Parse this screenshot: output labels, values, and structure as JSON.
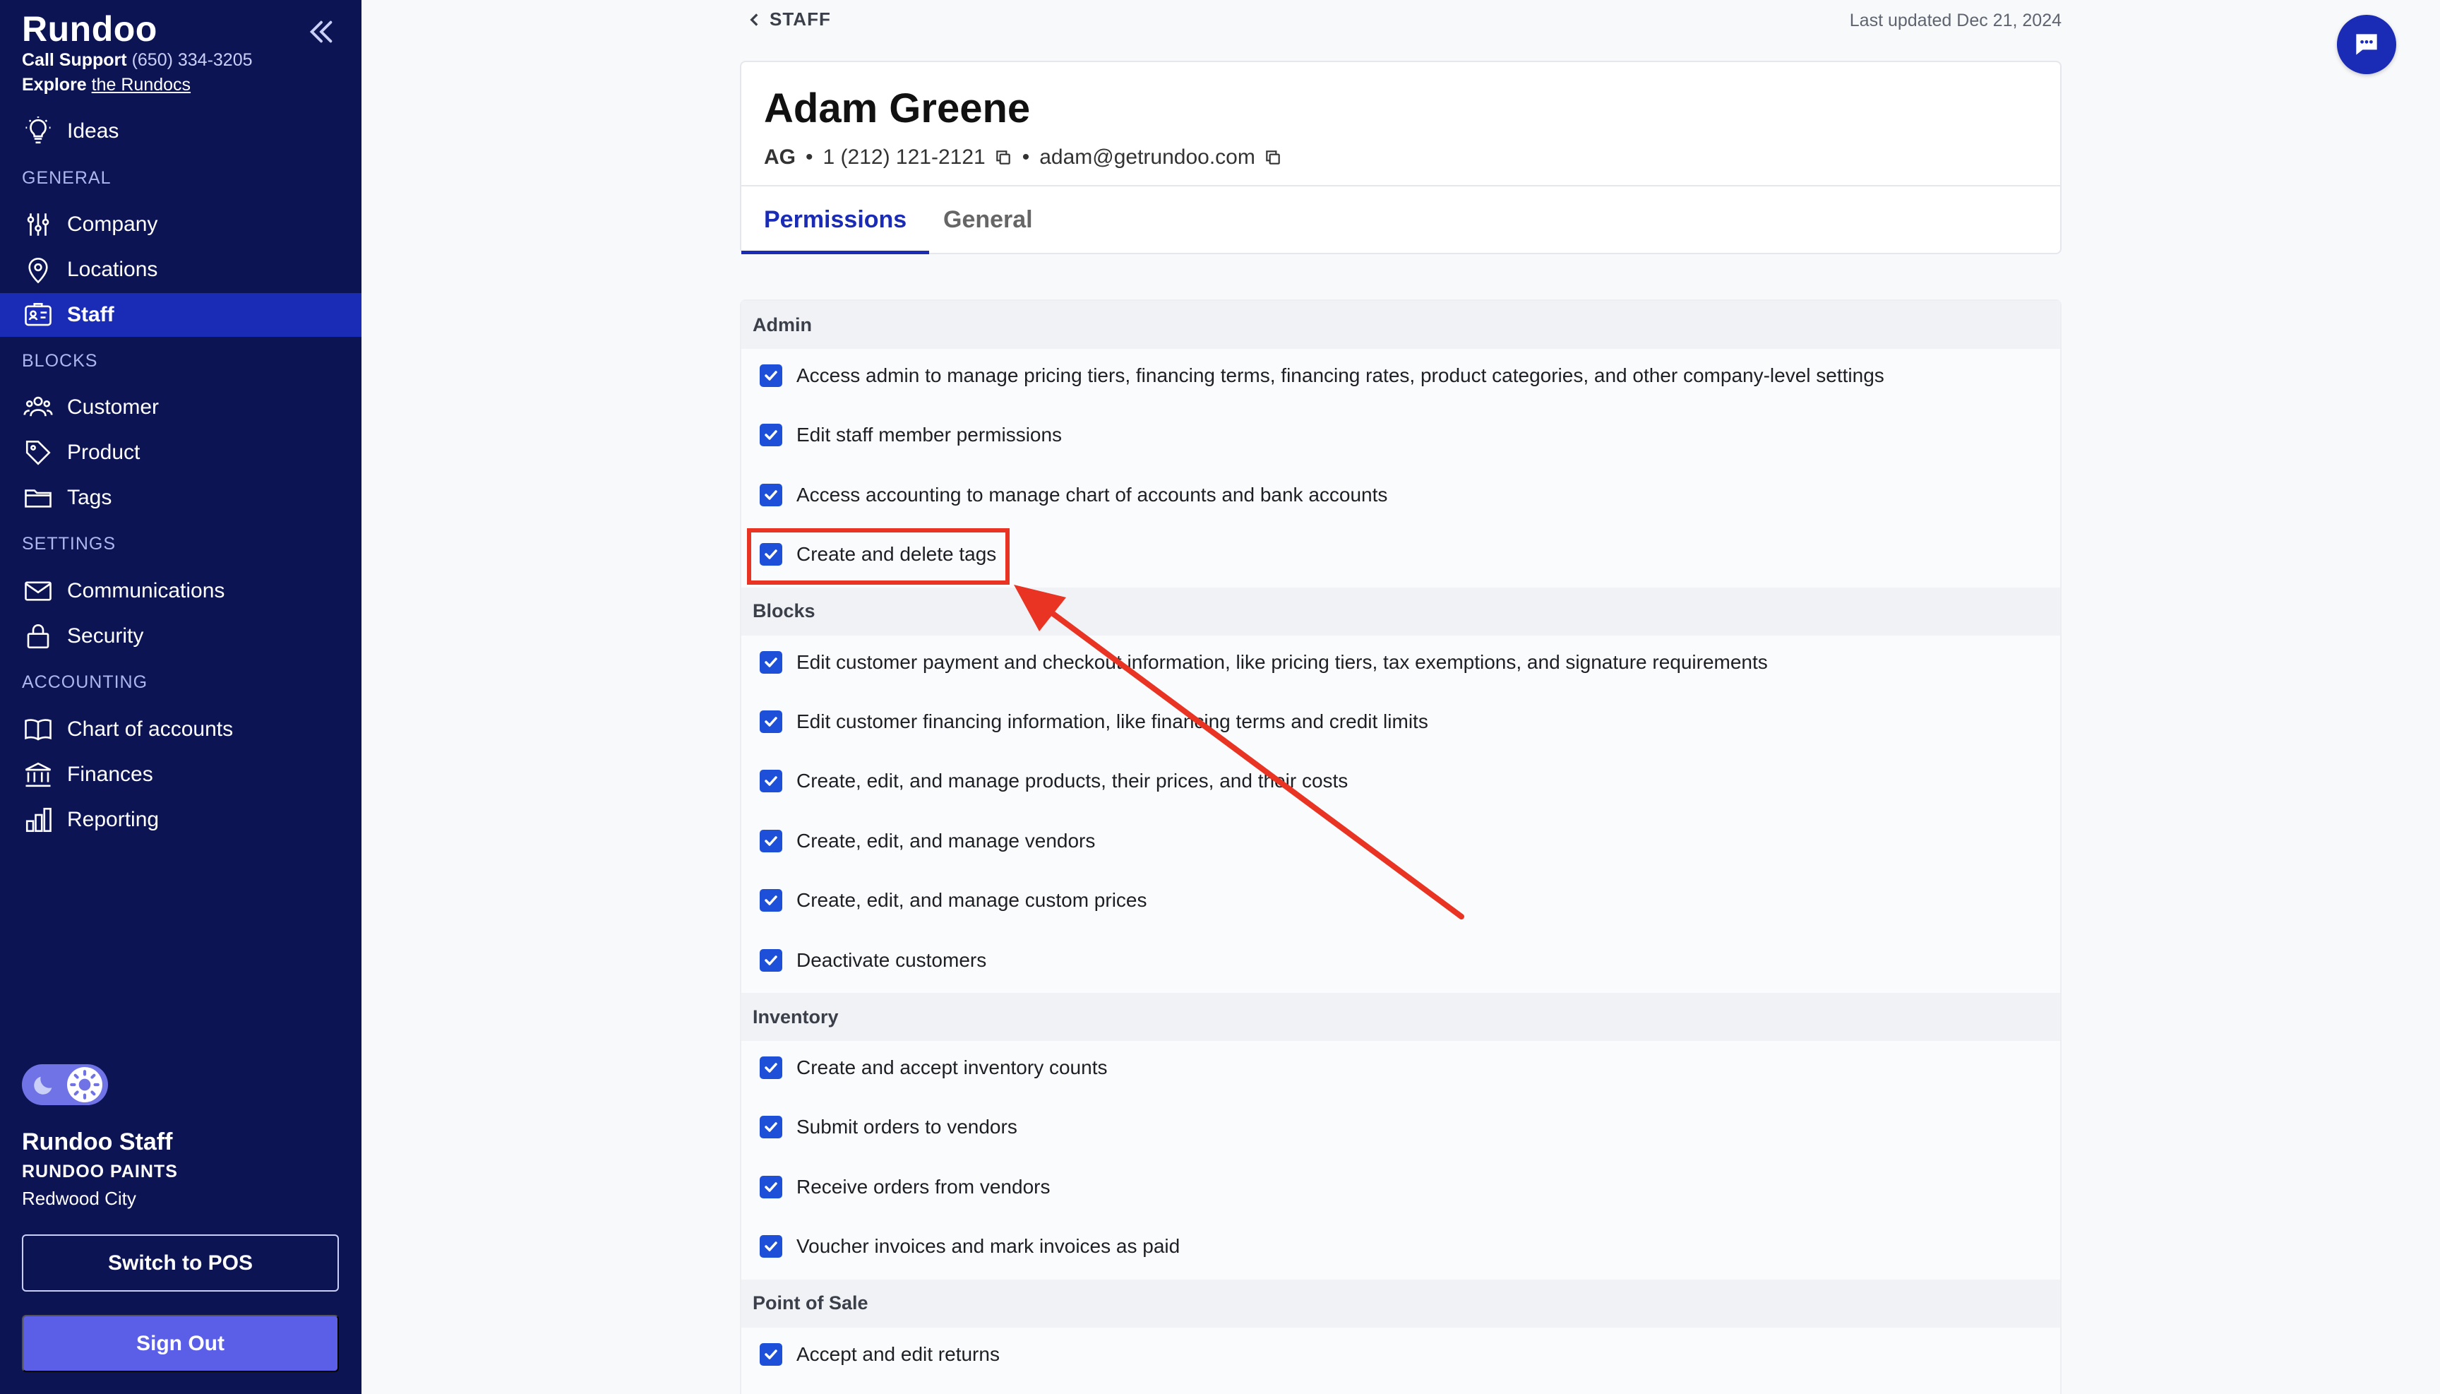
{
  "sidebar": {
    "brand": "Rundoo",
    "support_label": "Call Support",
    "support_phone": "(650) 334-3205",
    "explore_label": "Explore",
    "explore_link": "the Rundocs",
    "ideas": "Ideas",
    "section_general": "GENERAL",
    "company": "Company",
    "locations": "Locations",
    "staff": "Staff",
    "section_blocks": "BLOCKS",
    "customer": "Customer",
    "product": "Product",
    "tags": "Tags",
    "section_settings": "SETTINGS",
    "communications": "Communications",
    "security": "Security",
    "section_accounting": "ACCOUNTING",
    "chart_of_accounts": "Chart of accounts",
    "finances": "Finances",
    "reporting": "Reporting",
    "user_name": "Rundoo Staff",
    "user_company": "RUNDOO PAINTS",
    "user_city": "Redwood City",
    "switch_pos": "Switch to POS",
    "sign_out": "Sign Out"
  },
  "header": {
    "back_label": "STAFF",
    "last_updated": "Last updated Dec 21, 2024"
  },
  "profile": {
    "name": "Adam Greene",
    "initials": "AG",
    "phone": "1 (212) 121-2121",
    "email": "adam@getrundoo.com",
    "tab_permissions": "Permissions",
    "tab_general": "General"
  },
  "permissions": {
    "admin": {
      "title": "Admin",
      "items": [
        "Access admin to manage pricing tiers, financing terms, financing rates, product categories, and other company-level settings",
        "Edit staff member permissions",
        "Access accounting to manage chart of accounts and bank accounts",
        "Create and delete tags"
      ]
    },
    "blocks": {
      "title": "Blocks",
      "items": [
        "Edit customer payment and checkout information, like pricing tiers, tax exemptions, and signature requirements",
        "Edit customer financing information, like financing terms and credit limits",
        "Create, edit, and manage products, their prices, and their costs",
        "Create, edit, and manage vendors",
        "Create, edit, and manage custom prices",
        "Deactivate customers"
      ]
    },
    "inventory": {
      "title": "Inventory",
      "items": [
        "Create and accept inventory counts",
        "Submit orders to vendors",
        "Receive orders from vendors",
        "Voucher invoices and mark invoices as paid"
      ]
    },
    "pos": {
      "title": "Point of Sale",
      "items": [
        "Accept and edit returns"
      ]
    }
  },
  "colors": {
    "sidebar_bg": "#0c1453",
    "accent": "#1a2bb5",
    "checkbox": "#1e4fd8",
    "annotation": "#e93323"
  }
}
